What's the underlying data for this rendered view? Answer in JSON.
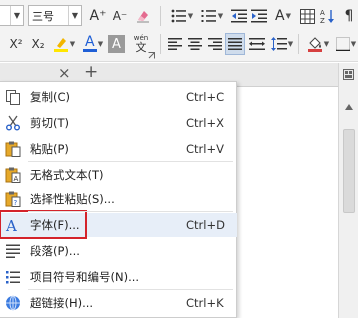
{
  "ribbon": {
    "font_size_value": "三号",
    "icons": {
      "grow_font": "A⁺",
      "shrink_font": "A⁻",
      "superscript": "X²",
      "subscript": "X₂",
      "font_color_letter": "A",
      "char_shading_letter": "A",
      "phonetic_top": "wén",
      "phonetic_bottom": "文",
      "text_effect_letter": "A",
      "table_icon": "table-icon"
    },
    "colors": {
      "font_color": "#1f5fd6",
      "highlight": "#ffe600"
    }
  },
  "tabstrip": {
    "close_glyph": "×",
    "add_glyph": "+"
  },
  "menu": {
    "items": [
      {
        "icon": "copy-icon",
        "label": "复制(C)",
        "shortcut": "Ctrl+C"
      },
      {
        "icon": "scissors-icon",
        "label": "剪切(T)",
        "shortcut": "Ctrl+X"
      },
      {
        "icon": "paste-icon",
        "label": "粘贴(P)",
        "shortcut": "Ctrl+V"
      },
      {
        "icon": "paste-text-icon",
        "label": "无格式文本(T)",
        "shortcut": ""
      },
      {
        "icon": "paste-special-icon",
        "label": "选择性粘贴(S)...",
        "shortcut": ""
      },
      {
        "icon": "font-icon",
        "label": "字体(F)...",
        "shortcut": "Ctrl+D",
        "highlighted": true
      },
      {
        "icon": "paragraph-icon",
        "label": "段落(P)...",
        "shortcut": ""
      },
      {
        "icon": "bullets-icon",
        "label": "项目符号和编号(N)...",
        "shortcut": ""
      },
      {
        "icon": "hyperlink-icon",
        "label": "超链接(H)...",
        "shortcut": "Ctrl+K"
      }
    ]
  }
}
